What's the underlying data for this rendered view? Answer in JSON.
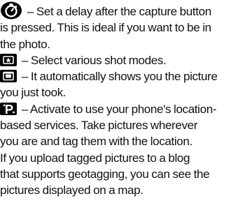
{
  "entries": [
    {
      "icon": "self-timer-icon",
      "lines": [
        " – Set a delay after the capture button",
        "is pressed. This is ideal if you want to be in",
        "the photo."
      ]
    },
    {
      "icon": "shot-mode-icon",
      "lines": [
        " – Select various shot modes."
      ]
    },
    {
      "icon": "auto-review-icon",
      "lines": [
        " – It automatically shows you the picture",
        "you just took."
      ]
    },
    {
      "icon": "geotag-icon",
      "lines": [
        " – Activate to use your phone's location-",
        "based services. Take pictures wherever",
        "you are and tag them with the location.",
        "If you upload tagged pictures to a blog",
        "that supports geotagging, you can see the",
        "pictures displayed on a map."
      ]
    }
  ]
}
